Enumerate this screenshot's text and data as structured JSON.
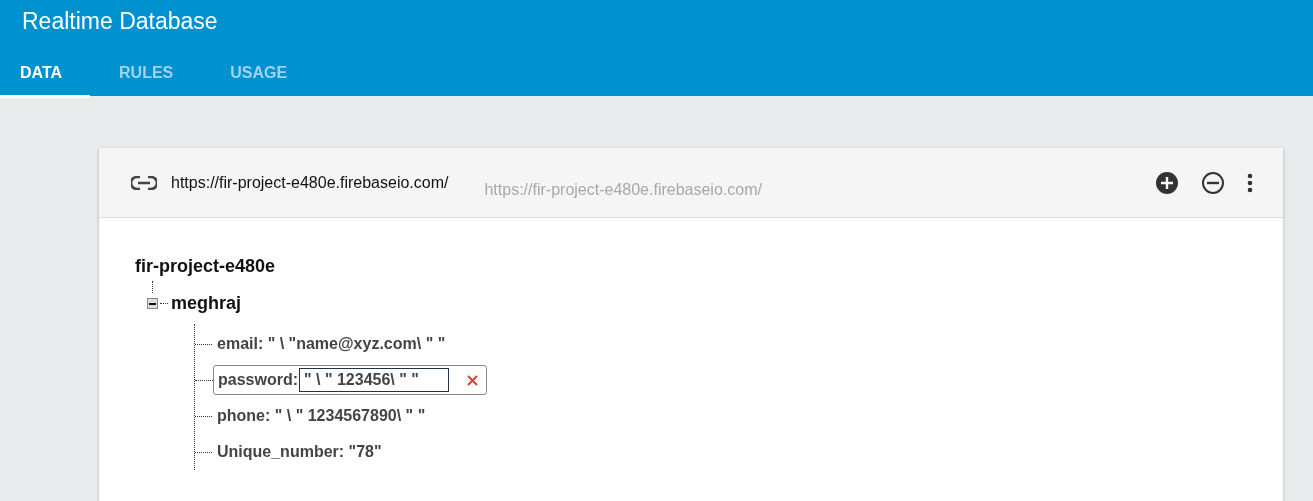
{
  "window": {
    "title": "Realtime Database"
  },
  "tabs": [
    {
      "label": "DATA",
      "selected": true
    },
    {
      "label": "RULES",
      "selected": false
    },
    {
      "label": "USAGE",
      "selected": false
    }
  ],
  "database": {
    "url": "https://fir-project-e480e.firebaseio.com/",
    "url_echo": "https://fir-project-e480e.firebaseio.com/"
  },
  "root": {
    "name": "fir-project-e480e",
    "children": [
      {
        "name": "meghraj",
        "expanded": true,
        "children": [
          {
            "key": "email:",
            "value": "\" \\ \"name@xyz.com\\ \" \"",
            "editing": false
          },
          {
            "key": "password:",
            "value": "\" \\ \" 123456\\ \" \"",
            "editing": true
          },
          {
            "key": "phone:",
            "value": "\" \\ \" 1234567890\\ \" \"",
            "editing": false
          },
          {
            "key": "Unique_number:",
            "value": "\"78\"",
            "editing": false
          }
        ]
      }
    ]
  }
}
